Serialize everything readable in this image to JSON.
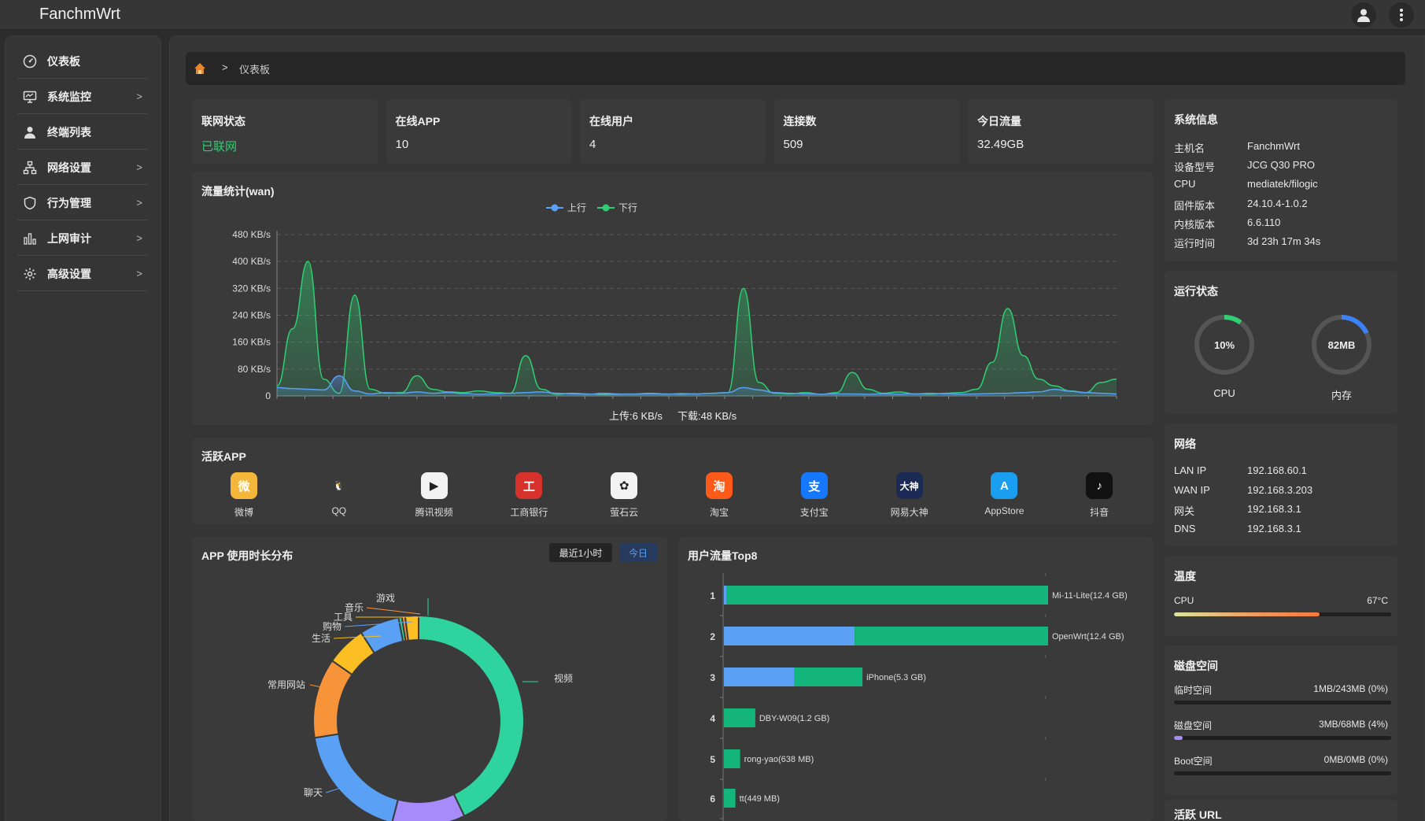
{
  "app": {
    "title": "FanchmWrt"
  },
  "sidebar": {
    "items": [
      {
        "label": "仪表板",
        "icon": "dashboard-icon",
        "has_submenu": false
      },
      {
        "label": "系统监控",
        "icon": "monitor-icon",
        "has_submenu": true
      },
      {
        "label": "终端列表",
        "icon": "user-icon",
        "has_submenu": false
      },
      {
        "label": "网络设置",
        "icon": "network-icon",
        "has_submenu": true
      },
      {
        "label": "行为管理",
        "icon": "shield-icon",
        "has_submenu": true
      },
      {
        "label": "上网审计",
        "icon": "bar-chart-icon",
        "has_submenu": true
      },
      {
        "label": "高级设置",
        "icon": "gear-icon",
        "has_submenu": true
      }
    ],
    "chevron": ">"
  },
  "breadcrumb": {
    "separator": ">",
    "current": "仪表板"
  },
  "stats": [
    {
      "title": "联网状态",
      "value": "已联网"
    },
    {
      "title": "在线APP",
      "value": "10"
    },
    {
      "title": "在线用户",
      "value": "4"
    },
    {
      "title": "连接数",
      "value": "509"
    },
    {
      "title": "今日流量",
      "value": "32.49GB"
    }
  ],
  "colors": {
    "green": "#2fcf72",
    "upload_blue": "#5aa0f5",
    "bar_green": "#13b57c",
    "donut_cyan": "#2fd39d"
  },
  "traffic": {
    "title": "流量统计(wan)",
    "upload_summary": "上传:6 KB/s",
    "download_summary": "下载:48 KB/s"
  },
  "chart_data": [
    {
      "type": "area",
      "title": "流量统计(wan)",
      "ylim": [
        0,
        480
      ],
      "yticks": [
        "0",
        "80 KB/s",
        "160 KB/s",
        "240 KB/s",
        "320 KB/s",
        "400 KB/s",
        "480 KB/s"
      ],
      "legend_position": "top-center",
      "grid": true,
      "series": [
        {
          "name": "上行",
          "color": "#5aa0f5",
          "values": [
            25,
            22,
            20,
            18,
            60,
            15,
            6,
            10,
            8,
            12,
            8,
            10,
            7,
            5,
            6,
            8,
            10,
            12,
            8,
            6,
            5,
            8,
            6,
            5,
            6,
            5,
            7,
            6,
            8,
            10,
            25,
            18,
            10,
            8,
            6,
            5,
            6,
            6,
            5,
            6,
            5,
            6,
            8,
            6,
            5,
            6,
            7,
            8,
            10,
            12,
            20,
            14,
            10,
            8,
            6
          ]
        },
        {
          "name": "下行",
          "color": "#2fcf72",
          "values": [
            30,
            200,
            400,
            50,
            8,
            300,
            20,
            8,
            10,
            60,
            20,
            12,
            10,
            15,
            10,
            8,
            120,
            20,
            5,
            8,
            6,
            4,
            5,
            6,
            8,
            6,
            5,
            6,
            8,
            10,
            320,
            40,
            8,
            6,
            10,
            5,
            10,
            70,
            20,
            8,
            12,
            6,
            5,
            8,
            10,
            20,
            100,
            260,
            120,
            50,
            30,
            15,
            10,
            40,
            50
          ]
        }
      ]
    },
    {
      "type": "pie",
      "title": "APP 使用时长分布",
      "categories": [
        "视频",
        "聊天",
        "常用网站",
        "生活",
        "购物",
        "工具",
        "音乐",
        "游戏"
      ],
      "values": [
        42,
        22,
        13,
        6,
        6,
        5,
        2,
        4
      ]
    },
    {
      "type": "bar",
      "title": "用户流量Top8",
      "categories": [
        "1",
        "2",
        "3",
        "4",
        "5",
        "6"
      ],
      "series": [
        {
          "name": "上行",
          "values": [
            0.1,
            5.0,
            2.7,
            0,
            0,
            0
          ]
        },
        {
          "name": "下行",
          "values": [
            12.3,
            7.4,
            2.6,
            1.2,
            0.62,
            0.44
          ]
        }
      ],
      "labels": [
        "Mi-11-Lite(12.4 GB)",
        "OpenWrt(12.4 GB)",
        "iPhone(5.3 GB)",
        "DBY-W09(1.2 GB)",
        "rong-yao(638 MB)",
        "tt(449 MB)"
      ]
    }
  ],
  "active_apps": {
    "title": "活跃APP",
    "apps": [
      {
        "name": "微博",
        "icon": "weibo-icon",
        "color": "#f5b73a",
        "glyph": "微"
      },
      {
        "name": "QQ",
        "icon": "qq-icon",
        "color": "#3a3a3a",
        "glyph": "🐧"
      },
      {
        "name": "腾讯视频",
        "icon": "tencent-video-icon",
        "color": "#f3f3f3",
        "glyph": "▶"
      },
      {
        "name": "工商银行",
        "icon": "icbc-icon",
        "color": "#d6312b",
        "glyph": "工"
      },
      {
        "name": "萤石云",
        "icon": "ezviz-icon",
        "color": "#f3f3f3",
        "glyph": "✿"
      },
      {
        "name": "淘宝",
        "icon": "taobao-icon",
        "color": "#ff5a17",
        "glyph": "淘"
      },
      {
        "name": "支付宝",
        "icon": "alipay-icon",
        "color": "#1677ff",
        "glyph": "支"
      },
      {
        "name": "网易大神",
        "icon": "netease-dashen-icon",
        "color": "#1a2a55",
        "glyph": "大神"
      },
      {
        "name": "AppStore",
        "icon": "appstore-icon",
        "color": "#1a9ff0",
        "glyph": "A"
      },
      {
        "name": "抖音",
        "icon": "douyin-icon",
        "color": "#111111",
        "glyph": "♪"
      }
    ]
  },
  "app_usage": {
    "title": "APP 使用时长分布",
    "btn_recent": "最近1小时",
    "btn_today": "今日"
  },
  "top_users": {
    "title": "用户流量Top8"
  },
  "system_info": {
    "title": "系统信息",
    "rows": [
      {
        "key": "主机名",
        "value": "FanchmWrt"
      },
      {
        "key": "设备型号",
        "value": "JCG Q30 PRO"
      },
      {
        "key": "CPU",
        "value": "mediatek/filogic"
      },
      {
        "key": "固件版本",
        "value": "24.10.4-1.0.2"
      },
      {
        "key": "内核版本",
        "value": "6.6.110"
      },
      {
        "key": "运行时间",
        "value": "3d 23h 17m 34s"
      }
    ]
  },
  "run_status": {
    "title": "运行状态",
    "cpu": {
      "value_text": "10%",
      "label": "CPU",
      "fraction": 0.1,
      "color": "#2fcf72"
    },
    "mem": {
      "value_text": "82MB",
      "label": "内存",
      "fraction": 0.18,
      "color": "#3b82f6"
    }
  },
  "network": {
    "title": "网络",
    "rows": [
      {
        "key": "LAN IP",
        "value": "192.168.60.1"
      },
      {
        "key": "WAN IP",
        "value": "192.168.3.203"
      },
      {
        "key": "网关",
        "value": "192.168.3.1"
      },
      {
        "key": "DNS",
        "value": "192.168.3.1"
      }
    ]
  },
  "temperature": {
    "title": "温度",
    "label": "CPU",
    "value": "67°C",
    "fraction": 0.67
  },
  "disk": {
    "title": "磁盘空间",
    "rows": [
      {
        "label": "临时空间",
        "value": "1MB/243MB (0%)",
        "fraction": 0.0,
        "color": "#a78bfa"
      },
      {
        "label": "磁盘空间",
        "value": "3MB/68MB (4%)",
        "fraction": 0.04,
        "color": "#a78bfa"
      },
      {
        "label": "Boot空间",
        "value": "0MB/0MB (0%)",
        "fraction": 0.0,
        "color": "#a78bfa"
      }
    ]
  },
  "active_url": {
    "title": "活跃 URL"
  }
}
